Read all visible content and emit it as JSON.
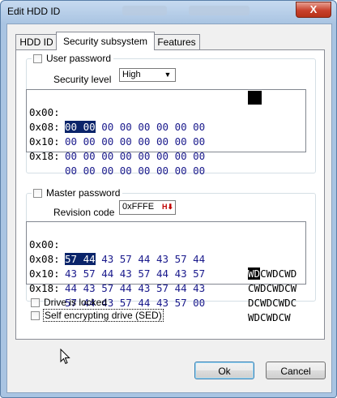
{
  "window": {
    "title": "Edit HDD ID",
    "close_label": "X"
  },
  "tabs": [
    {
      "label": "HDD ID",
      "active": false
    },
    {
      "label": "Security subsystem",
      "active": true
    },
    {
      "label": "Features",
      "active": false
    }
  ],
  "user_password": {
    "checkbox_label": "User password",
    "checked": false,
    "security_level_label": "Security level",
    "security_level_value": "High",
    "hex_rows": [
      {
        "addr": "0x00:",
        "bytes": [
          "00",
          "00",
          "00",
          "00",
          "00",
          "00",
          "00",
          "00"
        ],
        "ascii": ""
      },
      {
        "addr": "0x08:",
        "bytes": [
          "00",
          "00",
          "00",
          "00",
          "00",
          "00",
          "00",
          "00"
        ],
        "ascii": ""
      },
      {
        "addr": "0x10:",
        "bytes": [
          "00",
          "00",
          "00",
          "00",
          "00",
          "00",
          "00",
          "00"
        ],
        "ascii": ""
      },
      {
        "addr": "0x18:",
        "bytes": [
          "00",
          "00",
          "00",
          "00",
          "00",
          "00",
          "00",
          "00"
        ],
        "ascii": ""
      }
    ]
  },
  "master_password": {
    "checkbox_label": "Master password",
    "checked": false,
    "revision_code_label": "Revision code",
    "revision_code_value": "0xFFFE",
    "hex_rows": [
      {
        "addr": "0x00:",
        "bytes": [
          "57",
          "44",
          "43",
          "57",
          "44",
          "43",
          "57",
          "44"
        ],
        "ascii_sel": "WD",
        "ascii": "CWDCWD"
      },
      {
        "addr": "0x08:",
        "bytes": [
          "43",
          "57",
          "44",
          "43",
          "57",
          "44",
          "43",
          "57"
        ],
        "ascii_sel": "",
        "ascii": "CWDCWDCW"
      },
      {
        "addr": "0x10:",
        "bytes": [
          "44",
          "43",
          "57",
          "44",
          "43",
          "57",
          "44",
          "43"
        ],
        "ascii_sel": "",
        "ascii": "DCWDCWDC"
      },
      {
        "addr": "0x18:",
        "bytes": [
          "57",
          "44",
          "43",
          "57",
          "44",
          "43",
          "57",
          "00"
        ],
        "ascii_sel": "",
        "ascii": "WDCWDCW"
      }
    ]
  },
  "options": [
    {
      "label": "Drive is locked",
      "checked": false
    },
    {
      "label": "Self encrypting drive (SED)",
      "checked": false
    }
  ],
  "buttons": {
    "ok": "Ok",
    "cancel": "Cancel"
  }
}
